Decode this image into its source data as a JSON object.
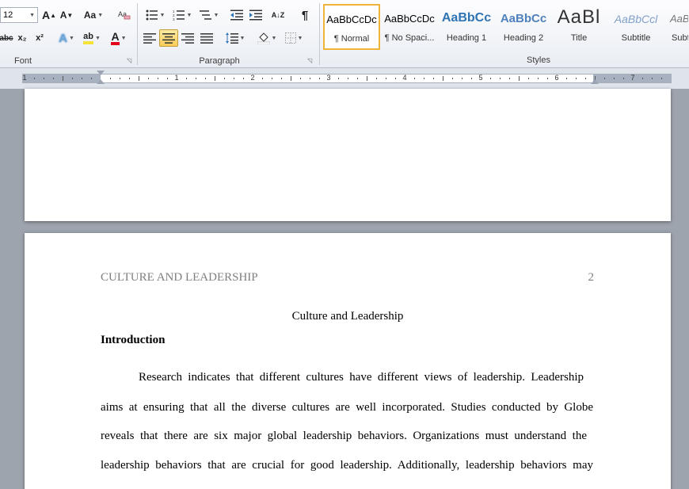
{
  "ribbon": {
    "font": {
      "label": "Font",
      "size_value": "12",
      "grow_label": "A",
      "shrink_label": "A",
      "case_label": "Aa",
      "strike_label": "abc",
      "subscript_label": "x₂",
      "superscript_label": "x²",
      "effects_label": "A",
      "highlight_label": "ab",
      "color_label": "A"
    },
    "paragraph": {
      "label": "Paragraph",
      "sort_label": "A↓Z",
      "pilcrow_label": "¶"
    },
    "styles": {
      "label": "Styles",
      "tiles": [
        {
          "sample": "AaBbCcDc",
          "name": "¶ Normal"
        },
        {
          "sample": "AaBbCcDc",
          "name": "¶ No Spaci..."
        },
        {
          "sample": "AaBbCc",
          "name": "Heading 1"
        },
        {
          "sample": "AaBbCc",
          "name": "Heading 2"
        },
        {
          "sample": "AaBl",
          "name": "Title"
        },
        {
          "sample": "AaBbCcl",
          "name": "Subtitle"
        },
        {
          "sample": "AaB",
          "name": "Subt"
        }
      ]
    }
  },
  "ruler": {
    "labels": [
      "1",
      "1",
      "2",
      "3",
      "4",
      "5",
      "6",
      "7"
    ]
  },
  "document": {
    "header_title": "CULTURE AND LEADERSHIP",
    "header_page": "2",
    "title": "Culture and Leadership",
    "section_heading": "Introduction",
    "lines": [
      "Research indicates that different cultures have different views of leadership. Leadership",
      "aims at ensuring that all the diverse cultures are well incorporated. Studies conducted by Globe",
      "reveals that there are six major global leadership behaviors.  Organizations must understand the",
      "leadership behaviors that are crucial for good leadership. Additionally, leadership behaviors may"
    ]
  },
  "colors": {
    "heading1": "#2e74b5",
    "heading2": "#4f81bd",
    "subtitle": "#7f9fc8",
    "header_text": "#7f7f7f",
    "font_color_bar": "#e3001b",
    "highlight_bar": "#f6e33a"
  }
}
